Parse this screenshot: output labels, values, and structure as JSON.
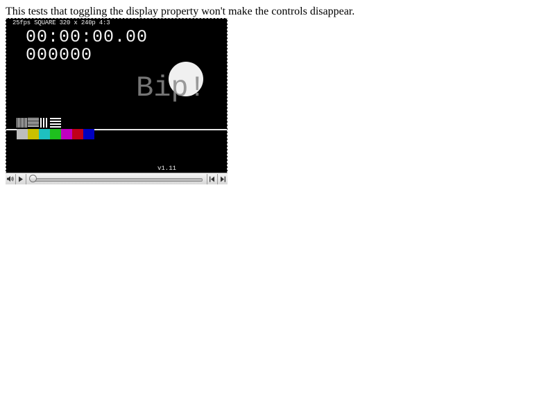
{
  "description": "This tests that toggling the display property won't make the controls disappear.",
  "video": {
    "info": "25fps SQUARE 320 x 240p 4:3",
    "timecode": "00:00:00.00",
    "frame_counter": "000000",
    "bip_label": "Bip!",
    "version": "v1.11",
    "color_bars": [
      "#bdbdbd",
      "#c8c000",
      "#1ec0c0",
      "#1ec01e",
      "#c000c0",
      "#c00018",
      "#0000c0"
    ]
  },
  "controls": {
    "volume_icon": "speaker-icon",
    "play_icon": "play-icon",
    "rewind_icon": "step-back-icon",
    "forward_icon": "step-forward-icon",
    "progress": 0
  }
}
